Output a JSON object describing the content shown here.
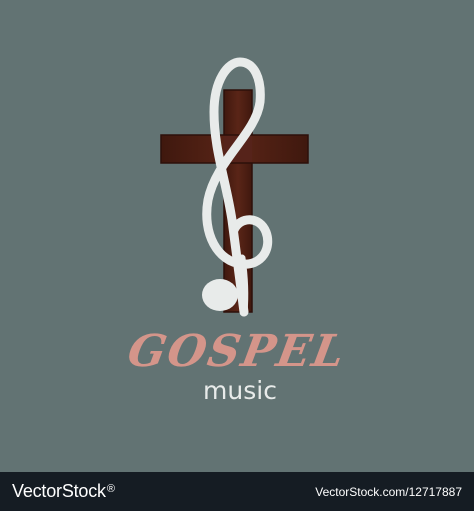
{
  "logo": {
    "title": "GOSPEL",
    "subtitle": "music",
    "icon": "cross-treble-clef-icon",
    "colors": {
      "background": "#627373",
      "cross": "#4d1f13",
      "clef": "#e8ebea",
      "title": "#d4958a",
      "subtitle": "#e8ebea"
    }
  },
  "footer": {
    "brand": "VectorStock",
    "brand_mark": "®",
    "stock_id": "VectorStock.com/12717887",
    "background": "#151c23"
  }
}
